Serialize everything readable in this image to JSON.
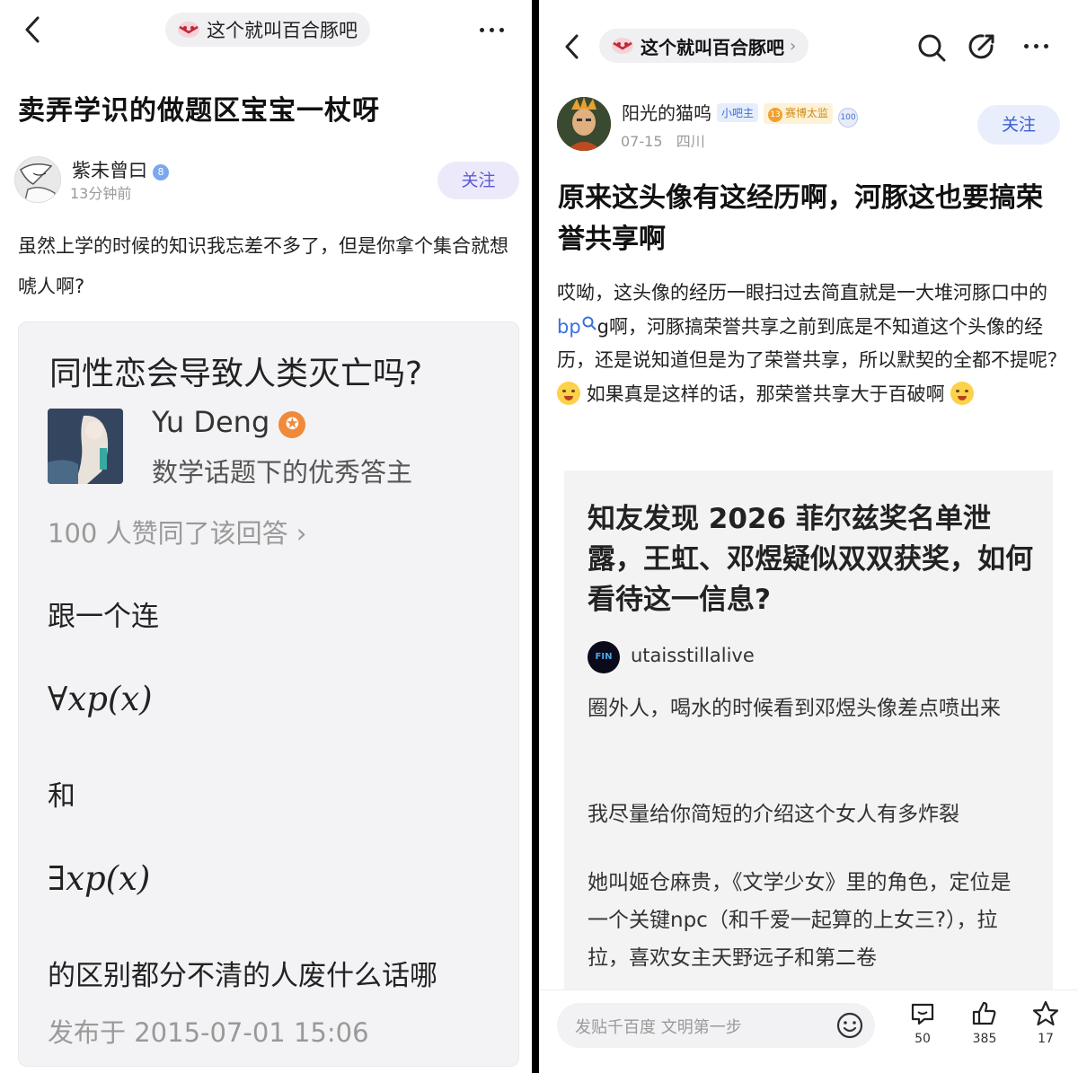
{
  "left": {
    "pill_label": "这个就叫百合豚吧",
    "title": "卖弄学识的做题区宝宝一杖呀",
    "author": {
      "name": "紫未曾曰",
      "level": "8",
      "time": "13分钟前"
    },
    "follow": "关注",
    "body": "虽然上学的时候的知识我忘差不多了，但是你拿个集合就想唬人啊?",
    "card": {
      "question": "同性恋会导致人类灭亡吗?",
      "answerer": "Yu Deng",
      "answerer_desc": "数学话题下的优秀答主",
      "votes": "100 人赞同了该回答 ›",
      "line1": "跟一个连",
      "formula1": "∀xp(x)",
      "line2": "和",
      "formula2": "∃xp(x)",
      "line3": "的区别都分不清的人废什么话哪",
      "published": "发布于 2015-07-01 15:06"
    }
  },
  "right": {
    "pill_label": "这个就叫百合豚吧",
    "author": {
      "name": "阳光的猫呜",
      "tag_admin": "小吧主",
      "level": "13",
      "tag_title": "赛博太监",
      "tag_100": "100",
      "date": "07-15",
      "location": "四川"
    },
    "follow": "关注",
    "title": "原来这头像有这经历啊，河豚这也要搞荣誉共享啊",
    "body": {
      "p1": "哎呦，这头像的经历一眼扫过去简直就是一大堆河豚口中的",
      "keyword": "bp",
      "p2": "g啊，河豚搞荣誉共享之前到底是不知道这个头像的经历，还是说知道但是为了荣誉共享，所以默契的全都不提呢？",
      "p3": "如果真是这样的话，那荣誉共享大于百破啊"
    },
    "card": {
      "question": "知友发现 2026 菲尔兹奖名单泄露，王虹、邓煜疑似双双获奖，如何看待这一信息?",
      "user": "utaisstillalive",
      "user_avatar_text": "FIN",
      "p1": "圈外人，喝水的时候看到邓煜头像差点喷出来",
      "p2": "我尽量给你简短的介绍这个女人有多炸裂",
      "p3": "她叫姬仓麻贵，《文学少女》里的角色，定位是一个关键npc（和千爱一起算的上女三?），拉拉，喜欢女主天野远子和第二卷"
    },
    "bottom": {
      "input_placeholder": "发贴千百度 文明第一步",
      "comments": "50",
      "likes": "385",
      "stars": "17"
    }
  },
  "colors": {
    "accent_blue": "#3a6fe0",
    "follow_bg": "#eceafa",
    "card_bg": "#f3f3f5"
  }
}
